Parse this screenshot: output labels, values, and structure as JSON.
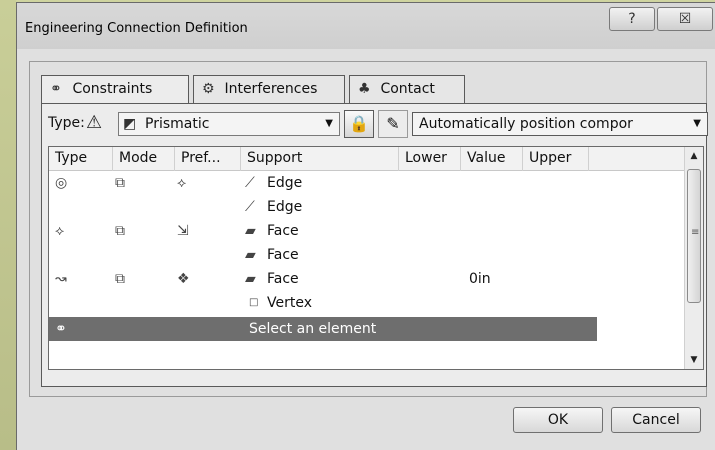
{
  "window": {
    "title": "Engineering Connection Definition",
    "help_label": "?",
    "close_label": "☒"
  },
  "tabs": [
    {
      "icon": "constraints-icon",
      "label": "Constraints",
      "active": true
    },
    {
      "icon": "interferences-icon",
      "label": "Interferences",
      "active": false
    },
    {
      "icon": "contact-icon",
      "label": "Contact",
      "active": false
    }
  ],
  "type_row": {
    "label": "Type:",
    "selected_type": "Prismatic",
    "position_option": "Automatically position compor"
  },
  "grid": {
    "columns": [
      "Type",
      "Mode",
      "Pref...",
      "Support",
      "Lower",
      "Value",
      "Upper"
    ],
    "rows": [
      {
        "type_icon": "circle-constraint-icon",
        "mode_icon": "mode-icon",
        "pref_icon": "pref-coincidence-icon",
        "support_icon": "edge-icon",
        "support": "Edge",
        "lower": "",
        "value": "",
        "upper": ""
      },
      {
        "type_icon": "",
        "mode_icon": "",
        "pref_icon": "",
        "support_icon": "edge-icon",
        "support": "Edge",
        "lower": "",
        "value": "",
        "upper": ""
      },
      {
        "type_icon": "plane-constraint-icon",
        "mode_icon": "mode-icon",
        "pref_icon": "pref-contact-icon",
        "support_icon": "face-icon",
        "support": "Face",
        "lower": "",
        "value": "",
        "upper": ""
      },
      {
        "type_icon": "",
        "mode_icon": "",
        "pref_icon": "",
        "support_icon": "face-icon",
        "support": "Face",
        "lower": "",
        "value": "",
        "upper": ""
      },
      {
        "type_icon": "offset-constraint-icon",
        "mode_icon": "mode-icon",
        "pref_icon": "pref-offset-icon",
        "support_icon": "face-icon",
        "support": "Face",
        "lower": "",
        "value": "0in",
        "upper": ""
      },
      {
        "type_icon": "",
        "mode_icon": "",
        "pref_icon": "",
        "support_icon": "vertex-icon",
        "support": "Vertex",
        "lower": "",
        "value": "",
        "upper": ""
      }
    ],
    "selected_row": {
      "type_icon": "link-icon",
      "support": "Select an element"
    }
  },
  "buttons": {
    "ok": "OK",
    "cancel": "Cancel"
  }
}
